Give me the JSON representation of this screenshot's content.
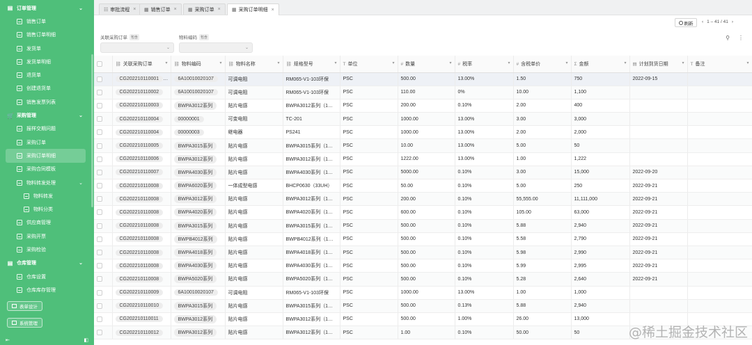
{
  "sidebar": {
    "rows": [
      {
        "kind": "group",
        "icon": "▤",
        "label": "订单管理",
        "chev": "⌄"
      },
      {
        "kind": "item",
        "label": "销售订单"
      },
      {
        "kind": "item",
        "label": "销售订单明细"
      },
      {
        "kind": "item",
        "label": "发货单"
      },
      {
        "kind": "item",
        "label": "发货单明细"
      },
      {
        "kind": "item",
        "label": "退货单"
      },
      {
        "kind": "item",
        "label": "创建退货单"
      },
      {
        "kind": "item",
        "label": "销售发票列表"
      },
      {
        "kind": "group",
        "icon": "🛒",
        "label": "采购管理",
        "chev": "⌄"
      },
      {
        "kind": "item",
        "label": "报样交期问题"
      },
      {
        "kind": "item",
        "label": "采购订单"
      },
      {
        "kind": "item",
        "label": "采购订单明细",
        "active": true
      },
      {
        "kind": "item",
        "label": "采购合同模板"
      },
      {
        "kind": "item",
        "label": "物料转发处理",
        "chev": "⌄"
      },
      {
        "kind": "sub",
        "label": "物料转发"
      },
      {
        "kind": "sub",
        "label": "物料分类"
      },
      {
        "kind": "item",
        "label": "供应商管理"
      },
      {
        "kind": "item",
        "label": "采购开票"
      },
      {
        "kind": "item",
        "label": "采购检验"
      },
      {
        "kind": "group",
        "icon": "▤",
        "label": "仓库管理",
        "chev": "⌄"
      },
      {
        "kind": "item",
        "label": "仓库设置"
      },
      {
        "kind": "item",
        "label": "仓库库存管理"
      }
    ],
    "btn_design": "表单设计",
    "btn_system": "系统管理",
    "footer_left": "⇤",
    "footer_right": "◧"
  },
  "tabs": [
    {
      "icon": "☷",
      "label": "审批流程",
      "close": "×"
    },
    {
      "icon": "▦",
      "label": "销售订单",
      "close": "×"
    },
    {
      "icon": "▦",
      "label": "采购订单",
      "close": "×"
    },
    {
      "icon": "▦",
      "label": "采购订单明细",
      "close": "×",
      "active": true
    }
  ],
  "toolbar": {
    "refresh_label": "刷新",
    "pager_prev": "‹",
    "pager_text": "1 – 41 / 41",
    "pager_next": "›"
  },
  "filters": [
    {
      "label": "关联采购订单",
      "badge": "包含"
    },
    {
      "label": "物料编码",
      "badge": "包含"
    }
  ],
  "filter_icons": [
    "⚲",
    "⋮"
  ],
  "table": {
    "columns": [
      {
        "icon": "",
        "label": ""
      },
      {
        "icon": "⛓",
        "label": "关联采购订单"
      },
      {
        "icon": "⛓",
        "label": "物料编码"
      },
      {
        "icon": "⛓",
        "label": "物料名称"
      },
      {
        "icon": "⛓",
        "label": "规格型号"
      },
      {
        "icon": "T",
        "label": "单位"
      },
      {
        "icon": "#",
        "label": "数量"
      },
      {
        "icon": "#",
        "label": "税率"
      },
      {
        "icon": "#",
        "label": "含税单价"
      },
      {
        "icon": "Σ",
        "label": "金额"
      },
      {
        "icon": "▤",
        "label": "计划到货日期"
      },
      {
        "icon": "T",
        "label": "备注"
      }
    ],
    "rows": [
      [
        "CG202210110001",
        "6A10010020107",
        "可调电阻",
        "RM065-V1-103环保",
        "PSC",
        "500.00",
        "13.00%",
        "1.50",
        "750",
        "2022-09-15",
        ""
      ],
      [
        "CG202210110002",
        "6A10010020107",
        "可调电阻",
        "RM065-V1-103环保",
        "PSC",
        "110.00",
        "0%",
        "10.00",
        "1,100",
        "",
        ""
      ],
      [
        "CG202210110003",
        "BWPA3012系列",
        "贴片电感",
        "BWPA3012系列（1…",
        "PSC",
        "200.00",
        "0.10%",
        "2.00",
        "400",
        "",
        ""
      ],
      [
        "CG202210110004",
        "00000001",
        "可变电阻",
        "TC-201",
        "PSC",
        "1000.00",
        "13.00%",
        "3.00",
        "3,000",
        "",
        ""
      ],
      [
        "CG202210110004",
        "00000003",
        "继电器",
        "PS241",
        "PSC",
        "1000.00",
        "13.00%",
        "2.00",
        "2,000",
        "",
        ""
      ],
      [
        "CG202210110005",
        "BWPA3015系列",
        "贴片电感",
        "BWPA3015系列（1…",
        "PSC",
        "10.00",
        "13.00%",
        "5.00",
        "50",
        "",
        ""
      ],
      [
        "CG202210110006",
        "BWPA3012系列",
        "贴片电感",
        "BWPA3012系列（1…",
        "PSC",
        "1222.00",
        "13.00%",
        "1.00",
        "1,222",
        "",
        ""
      ],
      [
        "CG202210110007",
        "BWPA4030系列",
        "贴片电感",
        "BWPA4030系列（1…",
        "PSC",
        "5000.00",
        "0.10%",
        "3.00",
        "15,000",
        "2022-09-20",
        ""
      ],
      [
        "CG202210110008",
        "BWPA6020系列",
        "一体成型电感",
        "BHCP0630（33UH）",
        "PSC",
        "50.00",
        "0.10%",
        "5.00",
        "250",
        "2022-09-21",
        ""
      ],
      [
        "CG202210110008",
        "BWPA3012系列",
        "贴片电感",
        "BWPA3012系列（1…",
        "PSC",
        "200.00",
        "0.10%",
        "55,555.00",
        "11,111,000",
        "2022-09-21",
        ""
      ],
      [
        "CG202210110008",
        "BWPA4020系列",
        "贴片电感",
        "BWPA4020系列（1…",
        "PSC",
        "600.00",
        "0.10%",
        "105.00",
        "63,000",
        "2022-09-21",
        ""
      ],
      [
        "CG202210110008",
        "BWPA3015系列",
        "贴片电感",
        "BWPA3015系列（1…",
        "PSC",
        "500.00",
        "0.10%",
        "5.88",
        "2,940",
        "2022-09-21",
        ""
      ],
      [
        "CG202210110008",
        "BWPB4012系列",
        "贴片电感",
        "BWPB4012系列（1…",
        "PSC",
        "500.00",
        "0.10%",
        "5.58",
        "2,790",
        "2022-09-21",
        ""
      ],
      [
        "CG202210110008",
        "BWPA4018系列",
        "贴片电感",
        "BWPA4018系列（1…",
        "PSC",
        "500.00",
        "0.10%",
        "5.98",
        "2,990",
        "2022-09-21",
        ""
      ],
      [
        "CG202210110008",
        "BWPA4030系列",
        "贴片电感",
        "BWPA4030系列（1…",
        "PSC",
        "500.00",
        "0.10%",
        "5.99",
        "2,995",
        "2022-09-21",
        ""
      ],
      [
        "CG202210110008",
        "BWPA5020系列",
        "贴片电感",
        "BWPA5020系列（1…",
        "PSC",
        "500.00",
        "0.10%",
        "5.28",
        "2,640",
        "2022-09-21",
        ""
      ],
      [
        "CG202210110009",
        "6A10010020107",
        "可调电阻",
        "RM065-V1-103环保",
        "PSC",
        "1000.00",
        "13.00%",
        "1.00",
        "1,000",
        "",
        ""
      ],
      [
        "CG202210110010",
        "BWPA3015系列",
        "贴片电感",
        "BWPA3015系列（1…",
        "PSC",
        "500.00",
        "0.13%",
        "5.88",
        "2,940",
        "",
        ""
      ],
      [
        "CG202210110011",
        "BWPA3012系列",
        "贴片电感",
        "BWPA3012系列（1…",
        "PSC",
        "500.00",
        "1.00%",
        "26.00",
        "13,000",
        "",
        ""
      ],
      [
        "CG202210110012",
        "BWPA3012系列",
        "贴片电感",
        "BWPA3012系列（1…",
        "PSC",
        "1.00",
        "0.10%",
        "50.00",
        "50",
        "",
        ""
      ]
    ]
  },
  "watermark": "@稀土掘金技术社区"
}
